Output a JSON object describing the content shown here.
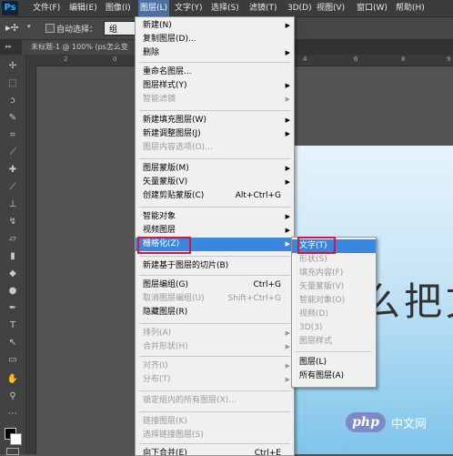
{
  "menubar": {
    "logo": "Ps",
    "items": [
      "文件(F)",
      "编辑(E)",
      "图像(I)",
      "图层(L)",
      "文字(Y)",
      "选择(S)",
      "滤镜(T)",
      "3D(D)",
      "视图(V)",
      "窗口(W)",
      "帮助(H)"
    ],
    "active_index": 3
  },
  "options_bar": {
    "auto_select_label": "自动选择：",
    "auto_select_value": "组"
  },
  "document_tab": {
    "title": "未标题-1 @ 100% (ps怎么变"
  },
  "ruler": {
    "marks": [
      "2",
      "0",
      "4",
      "6",
      "8",
      "9"
    ]
  },
  "layer_menu": {
    "items": [
      {
        "label": "新建(N)",
        "shortcut": "",
        "submenu": true,
        "disabled": false
      },
      {
        "label": "复制图层(D)...",
        "shortcut": "",
        "submenu": false,
        "disabled": false
      },
      {
        "label": "删除",
        "shortcut": "",
        "submenu": true,
        "disabled": false
      },
      {
        "label": "重命名图层...",
        "shortcut": "",
        "submenu": false,
        "disabled": false
      },
      {
        "label": "图层样式(Y)",
        "shortcut": "",
        "submenu": true,
        "disabled": false
      },
      {
        "label": "智能滤镜",
        "shortcut": "",
        "submenu": true,
        "disabled": true
      },
      {
        "label": "新建填充图层(W)",
        "shortcut": "",
        "submenu": true,
        "disabled": false
      },
      {
        "label": "新建调整图层(J)",
        "shortcut": "",
        "submenu": true,
        "disabled": false
      },
      {
        "label": "图层内容选项(O)...",
        "shortcut": "",
        "submenu": false,
        "disabled": true
      },
      {
        "label": "图层蒙版(M)",
        "shortcut": "",
        "submenu": true,
        "disabled": false
      },
      {
        "label": "矢量蒙版(V)",
        "shortcut": "",
        "submenu": true,
        "disabled": false
      },
      {
        "label": "创建剪贴蒙版(C)",
        "shortcut": "Alt+Ctrl+G",
        "submenu": false,
        "disabled": false
      },
      {
        "label": "智能对象",
        "shortcut": "",
        "submenu": true,
        "disabled": false
      },
      {
        "label": "视频图层",
        "shortcut": "",
        "submenu": true,
        "disabled": false
      },
      {
        "label": "栅格化(Z)",
        "shortcut": "",
        "submenu": true,
        "disabled": false,
        "highlighted": true
      },
      {
        "label": "新建基于图层的切片(B)",
        "shortcut": "",
        "submenu": false,
        "disabled": false
      },
      {
        "label": "图层编组(G)",
        "shortcut": "Ctrl+G",
        "submenu": false,
        "disabled": false
      },
      {
        "label": "取消图层编组(U)",
        "shortcut": "Shift+Ctrl+G",
        "submenu": false,
        "disabled": true
      },
      {
        "label": "隐藏图层(R)",
        "shortcut": "",
        "submenu": false,
        "disabled": false
      },
      {
        "label": "排列(A)",
        "shortcut": "",
        "submenu": true,
        "disabled": true
      },
      {
        "label": "合并形状(H)",
        "shortcut": "",
        "submenu": true,
        "disabled": true
      },
      {
        "label": "对齐(I)",
        "shortcut": "",
        "submenu": true,
        "disabled": true
      },
      {
        "label": "分布(T)",
        "shortcut": "",
        "submenu": true,
        "disabled": true
      },
      {
        "label": "锁定组内的所有图层(X)...",
        "shortcut": "",
        "submenu": false,
        "disabled": true
      },
      {
        "label": "链接图层(K)",
        "shortcut": "",
        "submenu": false,
        "disabled": true
      },
      {
        "label": "选择链接图层(S)",
        "shortcut": "",
        "submenu": false,
        "disabled": true
      },
      {
        "label": "向下合并(E)",
        "shortcut": "Ctrl+E",
        "submenu": false,
        "disabled": false
      }
    ]
  },
  "rasterize_submenu": {
    "items": [
      {
        "label": "文字(T)",
        "disabled": false,
        "highlighted": true
      },
      {
        "label": "形状(S)",
        "disabled": true
      },
      {
        "label": "填充内容(F)",
        "disabled": true
      },
      {
        "label": "矢量蒙版(V)",
        "disabled": true
      },
      {
        "label": "智能对象(O)",
        "disabled": true
      },
      {
        "label": "视频(D)",
        "disabled": true
      },
      {
        "label": "3D(3)",
        "disabled": true
      },
      {
        "label": "图层样式",
        "disabled": true
      },
      {
        "label": "图层(L)",
        "disabled": false
      },
      {
        "label": "所有图层(A)",
        "disabled": false
      }
    ]
  },
  "canvas": {
    "text": "么把文"
  },
  "watermark": {
    "logo": "php",
    "text": "中文网"
  },
  "colors": {
    "highlight": "#3a87e0",
    "annotation_red": "#e0123c",
    "menubar_active": "#4d6fa5"
  }
}
